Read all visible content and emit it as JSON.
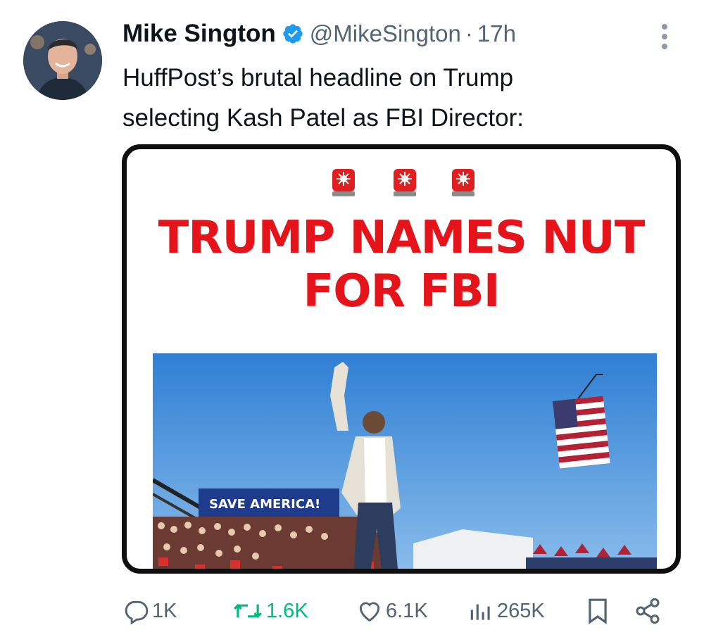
{
  "author": {
    "display_name": "Mike Sington",
    "handle": "@MikeSington",
    "separator": "·",
    "timestamp": "17h",
    "verified": true
  },
  "tweet": {
    "text_lines": [
      "HuffPost’s brutal headline on Trump",
      "selecting Kash Patel as FBI Director:"
    ]
  },
  "media": {
    "headline_lines": [
      "TRUMP NAMES NUT",
      "FOR FBI"
    ],
    "banner_text": "SAVE AMERICA!",
    "icons": [
      "siren-icon",
      "siren-icon",
      "siren-icon"
    ]
  },
  "actions": {
    "reply_count": "1K",
    "retweet_count": "1.6K",
    "like_count": "6.1K",
    "views_count": "265K"
  },
  "colors": {
    "headline_red": "#e5141a",
    "retweet_green": "#00ba7c",
    "verified_blue": "#1d9bf0",
    "secondary_text": "#536471"
  }
}
